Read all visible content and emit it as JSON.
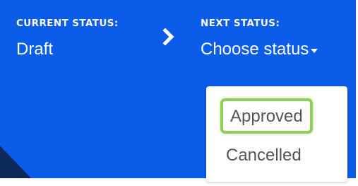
{
  "status_bar": {
    "background": "#0b5ce8",
    "current": {
      "label": "CURRENT STATUS:",
      "value": "Draft"
    },
    "separator_icon": "chevron-right-icon",
    "next": {
      "label": "NEXT STATUS:",
      "value": "Choose status",
      "dropdown_icon": "caret-down-icon"
    }
  },
  "dropdown": {
    "options": [
      {
        "label": "Approved",
        "highlighted": true,
        "highlight_color": "#8fcf5a"
      },
      {
        "label": "Cancelled",
        "highlighted": false
      }
    ]
  }
}
